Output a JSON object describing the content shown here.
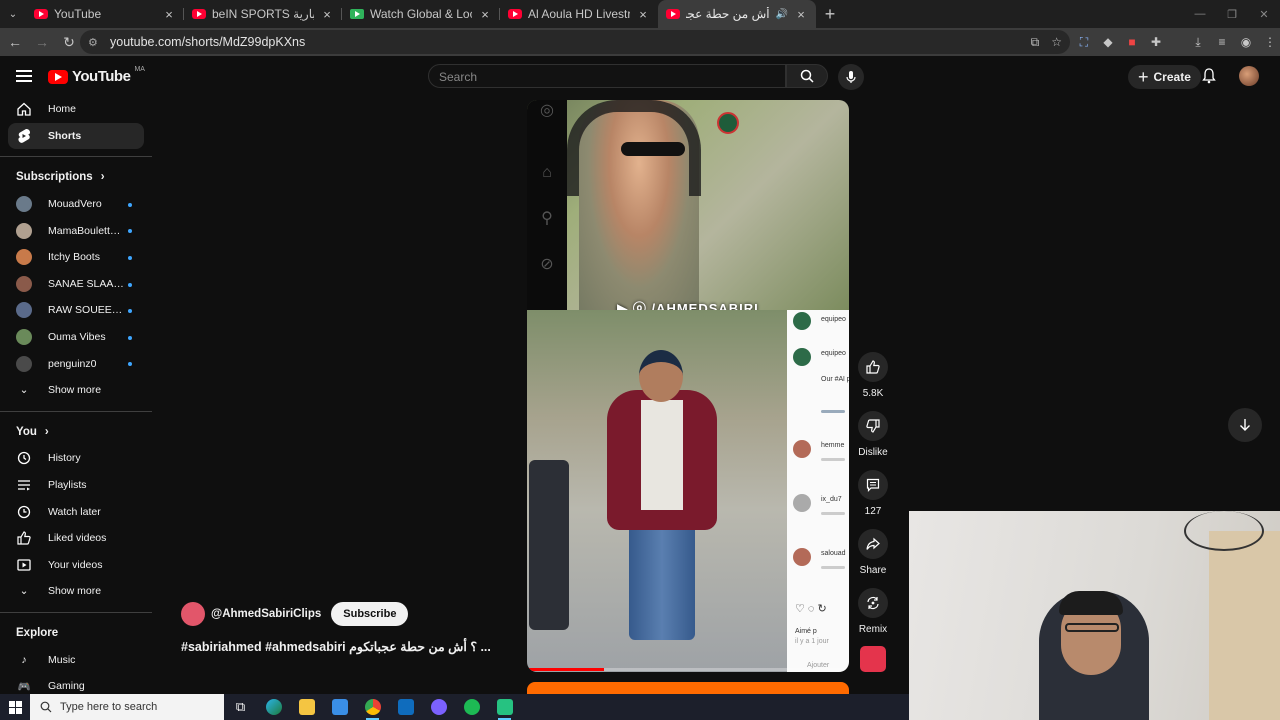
{
  "browser": {
    "tabs": [
      {
        "title": "YouTube",
        "favicon": "youtube-favicon"
      },
      {
        "title": "beIN SPORTS الإخبارية - YouTube",
        "favicon": "youtube-favicon"
      },
      {
        "title": "Watch Global & Local Live TV C",
        "favicon": "tv-favicon"
      },
      {
        "title": "Al Aoula HD Livestream 24/24 |",
        "favicon": "youtube-favicon"
      },
      {
        "title": "أش من حطة عجباتكوم ؟ #be",
        "favicon": "youtube-favicon",
        "active": true
      }
    ],
    "url": "youtube.com/shorts/MdZ99dpKXns"
  },
  "header": {
    "logo_text": "YouTube",
    "country_code": "MA",
    "search_placeholder": "Search",
    "create_label": "Create"
  },
  "sidebar": {
    "main": [
      {
        "label": "Home",
        "icon": "home-icon"
      },
      {
        "label": "Shorts",
        "icon": "shorts-icon",
        "active": true
      }
    ],
    "subscriptions_title": "Subscriptions",
    "subscriptions": [
      {
        "label": "MouadVero",
        "color": "#6a7a8a"
      },
      {
        "label": "MamaBoulettes...",
        "color": "#b0a090"
      },
      {
        "label": "Itchy Boots",
        "color": "#c87a4a"
      },
      {
        "label": "SANAE SLAAAY",
        "color": "#8a5a4a"
      },
      {
        "label": "RAW SOUEELT E...",
        "color": "#5a6a8a"
      },
      {
        "label": "Ouma Vibes",
        "color": "#6a8a5a"
      },
      {
        "label": "penguinz0",
        "color": "#4a4a4a"
      }
    ],
    "show_more": "Show more",
    "you_title": "You",
    "you_items": [
      {
        "label": "History",
        "icon": "history-icon"
      },
      {
        "label": "Playlists",
        "icon": "playlists-icon"
      },
      {
        "label": "Watch later",
        "icon": "watch-later-icon"
      },
      {
        "label": "Liked videos",
        "icon": "liked-videos-icon"
      },
      {
        "label": "Your videos",
        "icon": "your-videos-icon"
      }
    ],
    "show_more_2": "Show more",
    "explore_title": "Explore",
    "explore_items": [
      {
        "label": "Music",
        "icon": "music-icon"
      },
      {
        "label": "Gaming",
        "icon": "gaming-icon"
      }
    ]
  },
  "short": {
    "watermark": "▶ ⓞ /AHMEDSABIRI",
    "channel": "@AhmedSabiriClips",
    "subscribe_label": "Subscribe",
    "title": "#sabiriahmed #ahmedsabiri ؟ أش من حطة عجباتكوم ...",
    "progress": 0.24,
    "comments_preview": [
      {
        "name": "equipeo"
      },
      {
        "name": "equipeo",
        "line": "Our #Al prepara"
      },
      {
        "name": "hemme"
      },
      {
        "name": "ix_du7"
      },
      {
        "name": "salouad"
      }
    ],
    "comment_footer": "Aimé p",
    "comment_time": "il y a 1 jour",
    "add_comment": "Ajouter"
  },
  "actions": {
    "likes": "5.8K",
    "dislike": "Dislike",
    "comments": "127",
    "share": "Share",
    "remix": "Remix"
  },
  "taskbar": {
    "search_placeholder": "Type here to search"
  }
}
